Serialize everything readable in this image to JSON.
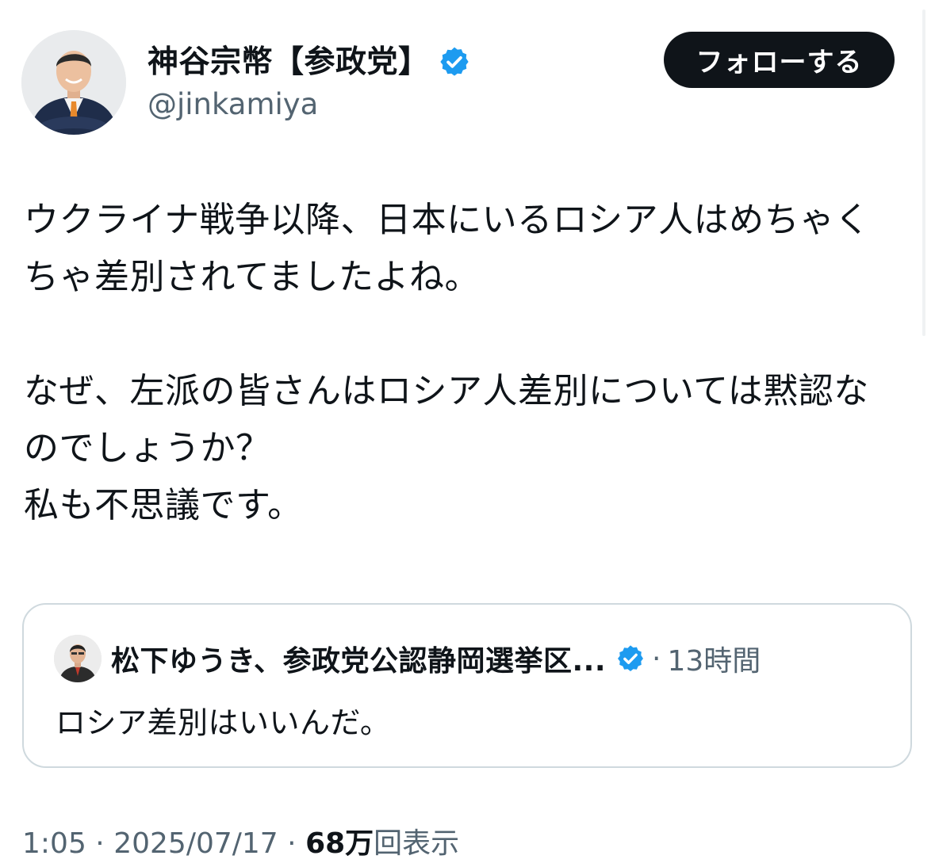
{
  "author": {
    "display_name": "神谷宗幣【参政党】",
    "handle": "@jinkamiya",
    "avatar_icon": "person-photo-icon",
    "verified_icon": "verified-badge-icon"
  },
  "follow_button": {
    "label": "フォローする"
  },
  "tweet": {
    "text": "ウクライナ戦争以降、日本にいるロシア人はめちゃくちゃ差別されてましたよね。\n\nなぜ、左派の皆さんはロシア人差別については黙認なのでしょうか？\n私も不思議です。"
  },
  "quoted_tweet": {
    "author_name": "松下ゆうき、参政党公認静岡選挙区...",
    "separator": "·",
    "time_ago": "13時間",
    "text": "ロシア差別はいいんだ。"
  },
  "footer": {
    "time": "1:05",
    "dot1": "·",
    "date": "2025/07/17",
    "dot2": "·",
    "views_count": "68万",
    "views_label": "回表示"
  },
  "colors": {
    "verified_blue": "#1d9bf0",
    "text_primary": "#0f1419",
    "text_secondary": "#536471",
    "border": "#cfd9de",
    "button_bg": "#0f1419"
  }
}
